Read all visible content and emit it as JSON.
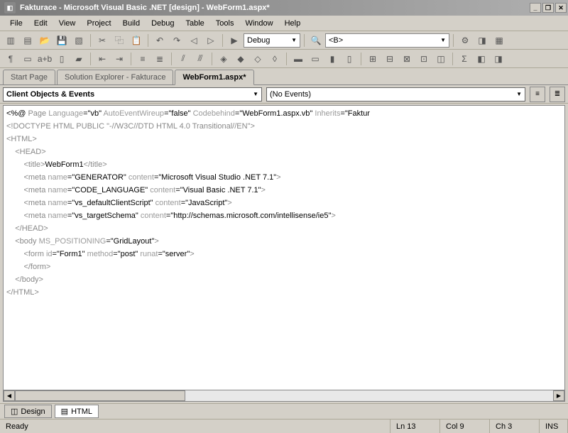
{
  "titlebar": {
    "text": "Fakturace - Microsoft Visual Basic .NET [design] - WebForm1.aspx*"
  },
  "menu": {
    "file": "File",
    "edit": "Edit",
    "view": "View",
    "project": "Project",
    "build": "Build",
    "debug": "Debug",
    "table": "Table",
    "tools": "Tools",
    "window": "Window",
    "help": "Help"
  },
  "combos": {
    "config": "Debug",
    "platform": "<B>"
  },
  "tabs": {
    "start": "Start Page",
    "sol": "Solution Explorer - Fakturace",
    "active": "WebForm1.aspx*"
  },
  "nav": {
    "objects": "Client Objects & Events",
    "events": "(No Events)"
  },
  "code": {
    "l1a": "<%@ ",
    "l1b": "Page",
    "l1c": " Language",
    "l1d": "=\"vb\"",
    "l1e": " AutoEventWireup",
    "l1f": "=\"false\"",
    "l1g": " Codebehind",
    "l1h": "=\"WebForm1.aspx.vb\"",
    "l1i": " Inherits",
    "l1j": "=\"Faktur",
    "l2": "<!DOCTYPE HTML PUBLIC \"-//W3C//DTD HTML 4.0 Transitional//EN\">",
    "l3": "<HTML>",
    "l4": "    <HEAD>",
    "l5a": "        <title>",
    "l5b": "WebForm1",
    "l5c": "</title>",
    "l6a": "        <meta ",
    "l6b": "name",
    "l6c": "=\"GENERATOR\"",
    "l6d": " content",
    "l6e": "=\"Microsoft Visual Studio .NET 7.1\"",
    "l6f": ">",
    "l7a": "        <meta ",
    "l7b": "name",
    "l7c": "=\"CODE_LANGUAGE\"",
    "l7d": " content",
    "l7e": "=\"Visual Basic .NET 7.1\"",
    "l7f": ">",
    "l8a": "        <meta ",
    "l8b": "name",
    "l8c": "=\"vs_defaultClientScript\"",
    "l8d": " content",
    "l8e": "=\"JavaScript\"",
    "l8f": ">",
    "l9a": "        <meta ",
    "l9b": "name",
    "l9c": "=\"vs_targetSchema\"",
    "l9d": " content",
    "l9e": "=\"http://schemas.microsoft.com/intellisense/ie5\"",
    "l9f": ">",
    "l10": "    </HEAD>",
    "l11a": "    <body ",
    "l11b": "MS_POSITIONING",
    "l11c": "=\"GridLayout\"",
    "l11d": ">",
    "l12a": "        <form ",
    "l12b": "id",
    "l12c": "=\"Form1\"",
    "l12d": " method",
    "l12e": "=\"post\"",
    "l12f": " runat",
    "l12g": "=\"server\"",
    "l12h": ">",
    "l13": "        </form>",
    "l14": "    </body>",
    "l15": "</HTML>"
  },
  "views": {
    "design": "Design",
    "html": "HTML"
  },
  "status": {
    "ready": "Ready",
    "ln": "Ln 13",
    "col": "Col 9",
    "ch": "Ch 3",
    "ins": "INS"
  }
}
